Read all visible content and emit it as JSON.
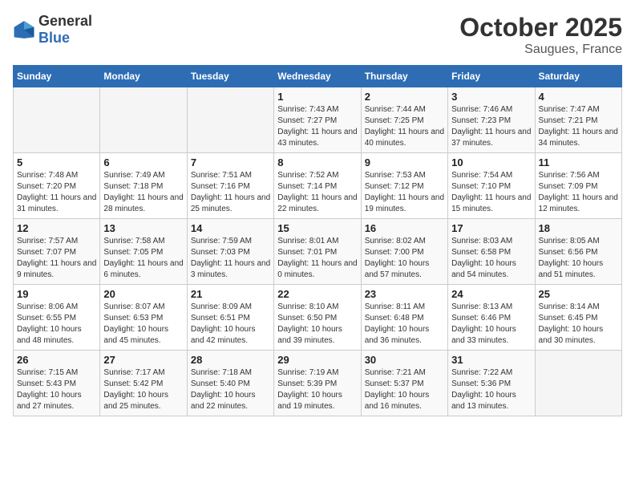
{
  "header": {
    "logo_general": "General",
    "logo_blue": "Blue",
    "month": "October 2025",
    "location": "Saugues, France"
  },
  "days_of_week": [
    "Sunday",
    "Monday",
    "Tuesday",
    "Wednesday",
    "Thursday",
    "Friday",
    "Saturday"
  ],
  "weeks": [
    [
      {
        "day": "",
        "info": ""
      },
      {
        "day": "",
        "info": ""
      },
      {
        "day": "",
        "info": ""
      },
      {
        "day": "1",
        "info": "Sunrise: 7:43 AM\nSunset: 7:27 PM\nDaylight: 11 hours and 43 minutes."
      },
      {
        "day": "2",
        "info": "Sunrise: 7:44 AM\nSunset: 7:25 PM\nDaylight: 11 hours and 40 minutes."
      },
      {
        "day": "3",
        "info": "Sunrise: 7:46 AM\nSunset: 7:23 PM\nDaylight: 11 hours and 37 minutes."
      },
      {
        "day": "4",
        "info": "Sunrise: 7:47 AM\nSunset: 7:21 PM\nDaylight: 11 hours and 34 minutes."
      }
    ],
    [
      {
        "day": "5",
        "info": "Sunrise: 7:48 AM\nSunset: 7:20 PM\nDaylight: 11 hours and 31 minutes."
      },
      {
        "day": "6",
        "info": "Sunrise: 7:49 AM\nSunset: 7:18 PM\nDaylight: 11 hours and 28 minutes."
      },
      {
        "day": "7",
        "info": "Sunrise: 7:51 AM\nSunset: 7:16 PM\nDaylight: 11 hours and 25 minutes."
      },
      {
        "day": "8",
        "info": "Sunrise: 7:52 AM\nSunset: 7:14 PM\nDaylight: 11 hours and 22 minutes."
      },
      {
        "day": "9",
        "info": "Sunrise: 7:53 AM\nSunset: 7:12 PM\nDaylight: 11 hours and 19 minutes."
      },
      {
        "day": "10",
        "info": "Sunrise: 7:54 AM\nSunset: 7:10 PM\nDaylight: 11 hours and 15 minutes."
      },
      {
        "day": "11",
        "info": "Sunrise: 7:56 AM\nSunset: 7:09 PM\nDaylight: 11 hours and 12 minutes."
      }
    ],
    [
      {
        "day": "12",
        "info": "Sunrise: 7:57 AM\nSunset: 7:07 PM\nDaylight: 11 hours and 9 minutes."
      },
      {
        "day": "13",
        "info": "Sunrise: 7:58 AM\nSunset: 7:05 PM\nDaylight: 11 hours and 6 minutes."
      },
      {
        "day": "14",
        "info": "Sunrise: 7:59 AM\nSunset: 7:03 PM\nDaylight: 11 hours and 3 minutes."
      },
      {
        "day": "15",
        "info": "Sunrise: 8:01 AM\nSunset: 7:01 PM\nDaylight: 11 hours and 0 minutes."
      },
      {
        "day": "16",
        "info": "Sunrise: 8:02 AM\nSunset: 7:00 PM\nDaylight: 10 hours and 57 minutes."
      },
      {
        "day": "17",
        "info": "Sunrise: 8:03 AM\nSunset: 6:58 PM\nDaylight: 10 hours and 54 minutes."
      },
      {
        "day": "18",
        "info": "Sunrise: 8:05 AM\nSunset: 6:56 PM\nDaylight: 10 hours and 51 minutes."
      }
    ],
    [
      {
        "day": "19",
        "info": "Sunrise: 8:06 AM\nSunset: 6:55 PM\nDaylight: 10 hours and 48 minutes."
      },
      {
        "day": "20",
        "info": "Sunrise: 8:07 AM\nSunset: 6:53 PM\nDaylight: 10 hours and 45 minutes."
      },
      {
        "day": "21",
        "info": "Sunrise: 8:09 AM\nSunset: 6:51 PM\nDaylight: 10 hours and 42 minutes."
      },
      {
        "day": "22",
        "info": "Sunrise: 8:10 AM\nSunset: 6:50 PM\nDaylight: 10 hours and 39 minutes."
      },
      {
        "day": "23",
        "info": "Sunrise: 8:11 AM\nSunset: 6:48 PM\nDaylight: 10 hours and 36 minutes."
      },
      {
        "day": "24",
        "info": "Sunrise: 8:13 AM\nSunset: 6:46 PM\nDaylight: 10 hours and 33 minutes."
      },
      {
        "day": "25",
        "info": "Sunrise: 8:14 AM\nSunset: 6:45 PM\nDaylight: 10 hours and 30 minutes."
      }
    ],
    [
      {
        "day": "26",
        "info": "Sunrise: 7:15 AM\nSunset: 5:43 PM\nDaylight: 10 hours and 27 minutes."
      },
      {
        "day": "27",
        "info": "Sunrise: 7:17 AM\nSunset: 5:42 PM\nDaylight: 10 hours and 25 minutes."
      },
      {
        "day": "28",
        "info": "Sunrise: 7:18 AM\nSunset: 5:40 PM\nDaylight: 10 hours and 22 minutes."
      },
      {
        "day": "29",
        "info": "Sunrise: 7:19 AM\nSunset: 5:39 PM\nDaylight: 10 hours and 19 minutes."
      },
      {
        "day": "30",
        "info": "Sunrise: 7:21 AM\nSunset: 5:37 PM\nDaylight: 10 hours and 16 minutes."
      },
      {
        "day": "31",
        "info": "Sunrise: 7:22 AM\nSunset: 5:36 PM\nDaylight: 10 hours and 13 minutes."
      },
      {
        "day": "",
        "info": ""
      }
    ]
  ]
}
